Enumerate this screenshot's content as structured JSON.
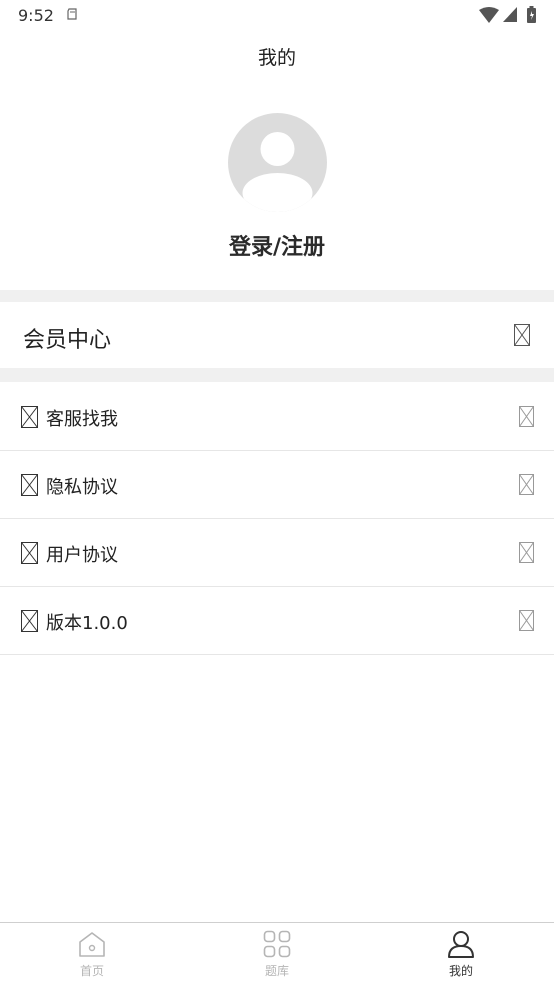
{
  "status_bar": {
    "time": "9:52"
  },
  "header": {
    "title": "我的"
  },
  "profile": {
    "login_label": "登录/注册"
  },
  "member": {
    "label": "会员中心"
  },
  "menu": {
    "items": [
      {
        "label": "客服找我"
      },
      {
        "label": "隐私协议"
      },
      {
        "label": "用户协议"
      },
      {
        "label": "版本1.0.0"
      }
    ]
  },
  "bottom_nav": {
    "items": [
      {
        "label": "首页",
        "icon": "home-icon",
        "active": false
      },
      {
        "label": "题库",
        "icon": "grid-icon",
        "active": false
      },
      {
        "label": "我的",
        "icon": "user-icon",
        "active": true
      }
    ]
  },
  "colors": {
    "inactive": "#b5b5b5",
    "active": "#333333",
    "section_gap": "#f0f0f0",
    "avatar": "#dcdcdc"
  }
}
